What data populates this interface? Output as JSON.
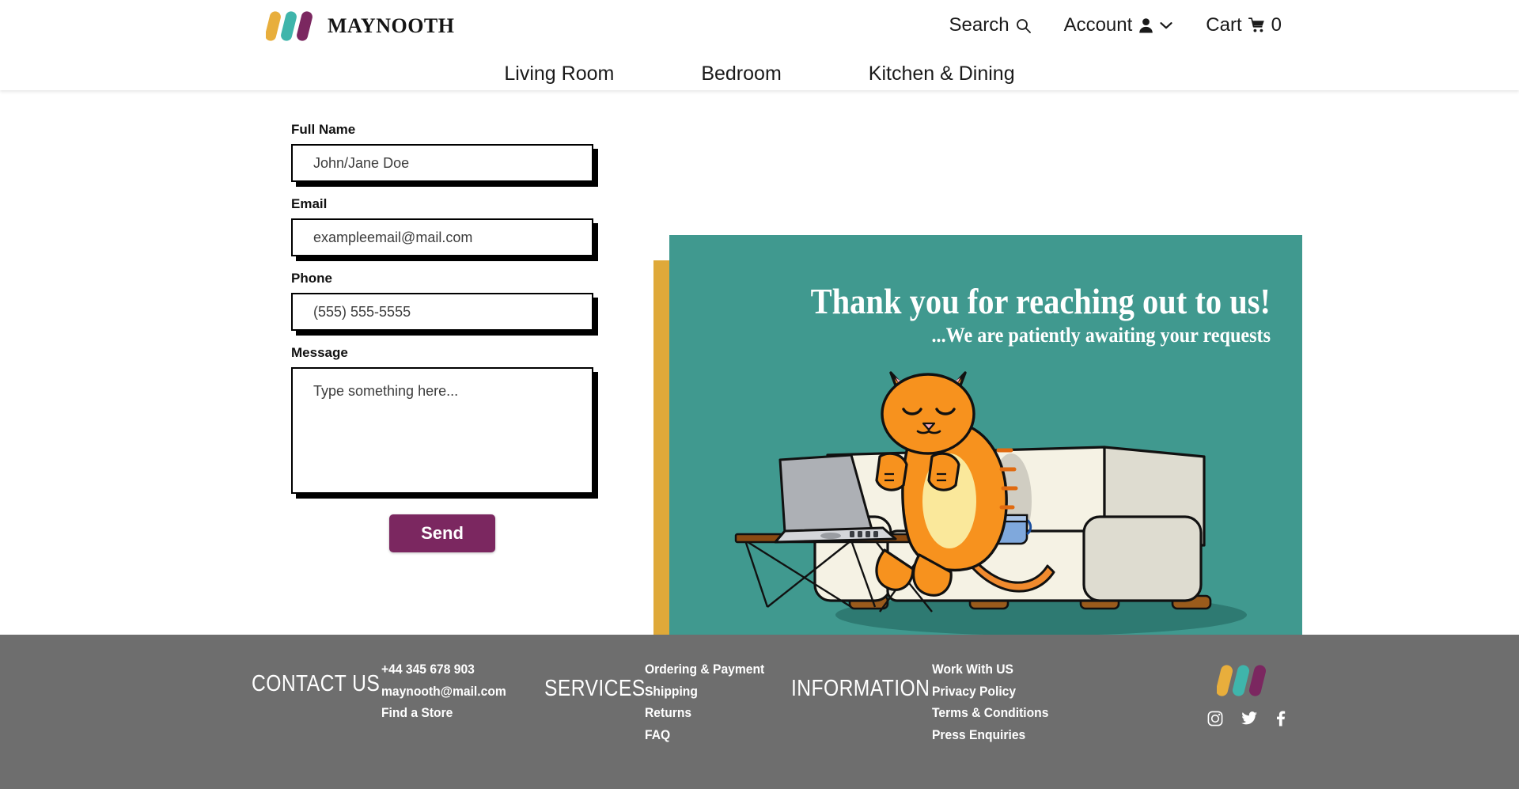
{
  "brand": {
    "name": "MAYNOOTH",
    "logo_colors": [
      "#E8AE3C",
      "#3FB5AB",
      "#7B2760"
    ]
  },
  "header": {
    "actions": [
      {
        "label": "Search",
        "icon": "search-icon"
      },
      {
        "label": "Account",
        "icon": "user-icon",
        "caret": "chevron-down-icon"
      },
      {
        "label": "Cart",
        "icon": "cart-icon",
        "count": "0"
      }
    ],
    "nav": [
      {
        "label": "Living Room"
      },
      {
        "label": "Bedroom"
      },
      {
        "label": "Kitchen & Dining"
      }
    ]
  },
  "form": {
    "fields": [
      {
        "label": "Full Name",
        "placeholder": "John/Jane Doe",
        "type": "text"
      },
      {
        "label": "Email",
        "placeholder": "exampleemail@mail.com",
        "type": "email"
      },
      {
        "label": "Phone",
        "placeholder": "(555) 555-5555",
        "type": "tel"
      },
      {
        "label": "Message",
        "placeholder": "Type something here...",
        "type": "textarea"
      }
    ],
    "submit_label": "Send",
    "submit_color": "#7B2760"
  },
  "promo": {
    "title": "Thank you for reaching out to us!",
    "subtitle": "...We are patiently awaiting your requests",
    "panel_color": "#40998F",
    "shadow_color": "#DFA939",
    "illustration": "cat-on-sofa-with-laptop"
  },
  "footer": {
    "background": "#6E6E6E",
    "columns": [
      {
        "heading": "CONTACT US",
        "links": [
          "+44 345 678 903",
          "maynooth@mail.com",
          "Find a Store"
        ]
      },
      {
        "heading": "SERVICES",
        "links": [
          "Ordering & Payment",
          "Shipping",
          "Returns",
          "FAQ"
        ]
      },
      {
        "heading": "INFORMATION",
        "links": [
          "Work With US",
          "Privacy Policy",
          "Terms & Conditions",
          "Press Enquiries"
        ]
      }
    ],
    "social": [
      {
        "name": "instagram-icon"
      },
      {
        "name": "twitter-icon"
      },
      {
        "name": "facebook-icon"
      }
    ]
  }
}
